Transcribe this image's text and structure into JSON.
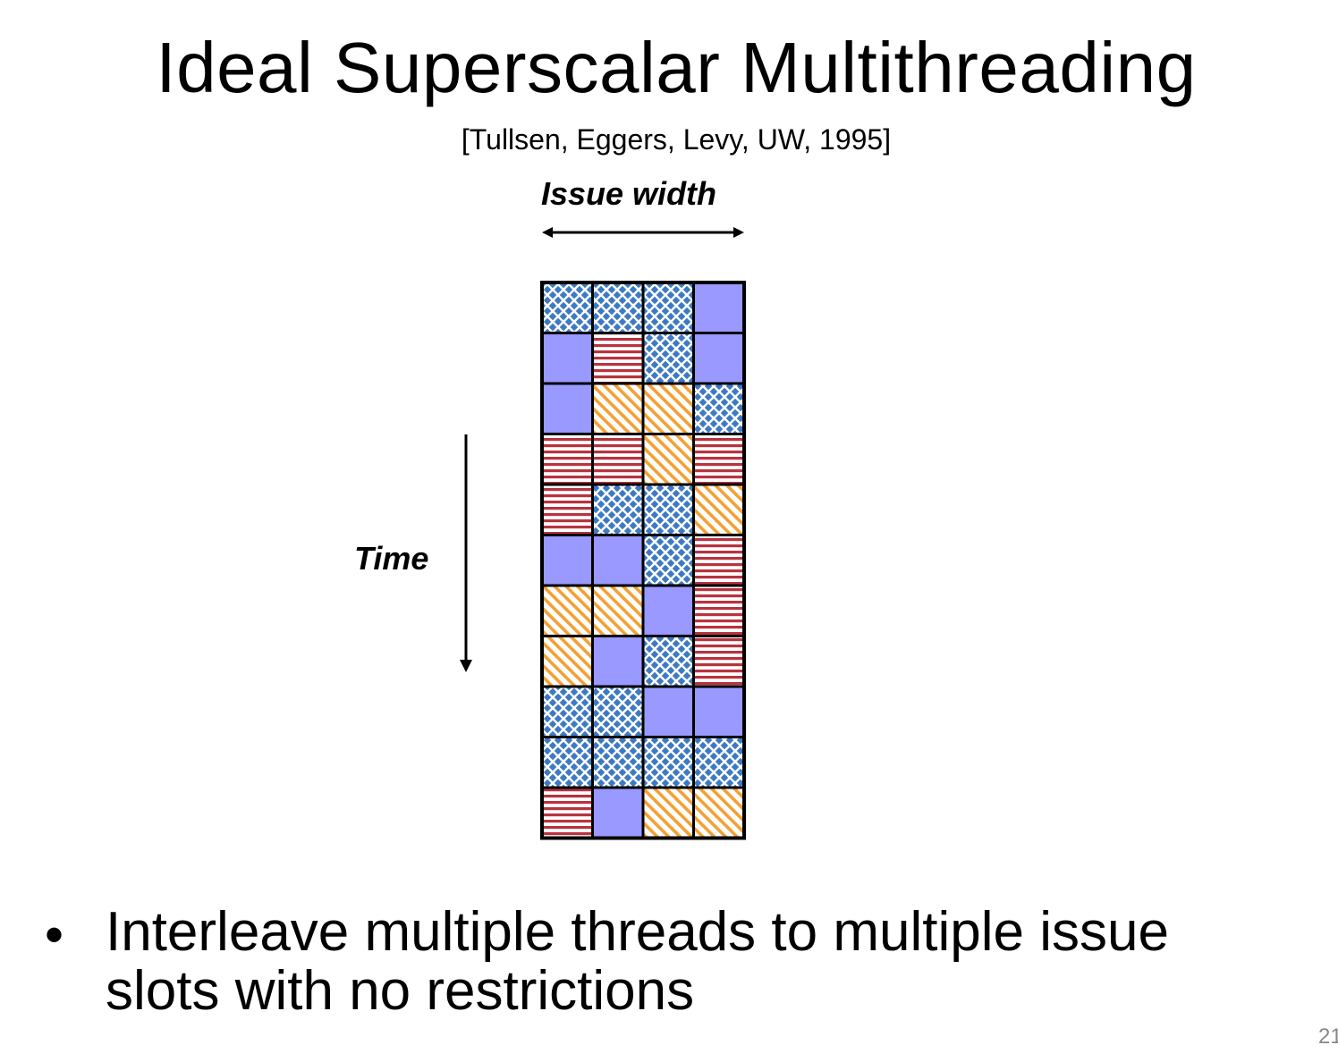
{
  "title": "Ideal Superscalar Multithreading",
  "citation": "[Tullsen, Eggers, Levy, UW, 1995]",
  "issue_width_label": "Issue width",
  "time_label": "Time",
  "bullet": "Interleave multiple threads to multiple issue slots with no restrictions",
  "page_number": "21",
  "thread_patterns": {
    "A": "solid-lavender",
    "B": "blue-diamond-dots",
    "C": "red-horizontal-stripes",
    "D": "orange-diagonal-stripes"
  },
  "colors": {
    "solid": "#9999ff",
    "dots": "#3d79c4",
    "stripes_red": "#b8333f",
    "stripes_orange": "#f4a034"
  },
  "slot_grid": [
    [
      "B",
      "B",
      "B",
      "A"
    ],
    [
      "A",
      "C",
      "B",
      "A"
    ],
    [
      "A",
      "D",
      "D",
      "B"
    ],
    [
      "C",
      "C",
      "D",
      "C"
    ],
    [
      "C",
      "B",
      "B",
      "D"
    ],
    [
      "A",
      "A",
      "B",
      "C"
    ],
    [
      "D",
      "D",
      "A",
      "C"
    ],
    [
      "D",
      "A",
      "B",
      "C"
    ],
    [
      "B",
      "B",
      "A",
      "A"
    ],
    [
      "B",
      "B",
      "B",
      "B"
    ],
    [
      "C",
      "A",
      "D",
      "D"
    ]
  ]
}
